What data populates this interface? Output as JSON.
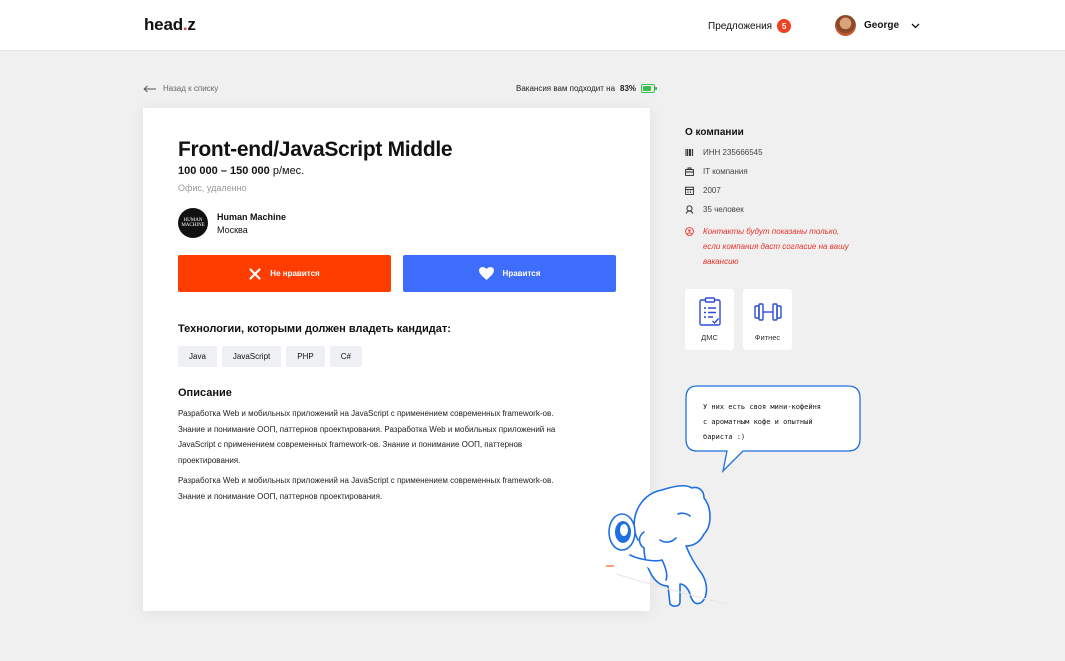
{
  "header": {
    "logo_main": "head",
    "logo_dot": ".",
    "logo_tail": "z",
    "offers_label": "Предложения",
    "offers_count": "5",
    "user_name": "George"
  },
  "nav": {
    "back_label": "Назад к списку",
    "match_label": "Вакансия вам подходит на",
    "match_value": "83%",
    "match_fraction": 0.83
  },
  "vacancy": {
    "title": "Front-end/JavaScript Middle",
    "salary_range": "100 000 – 150 000",
    "salary_unit": "р/мес.",
    "work_type": "Офис, удаленно",
    "company_name": "Human Machine",
    "company_city": "Москва",
    "company_logo_text": "HUMAN MACHINE",
    "dislike_label": "Не нравится",
    "like_label": "Нравится",
    "tech_heading": "Технологии, которыми должен владеть кандидат:",
    "tech_tags": [
      "Java",
      "JavaScript",
      "PHP",
      "C#"
    ],
    "desc_heading": "Описание",
    "desc_paragraphs": [
      "Разработка Web и мобильных приложений на JavaScript с применением современных framework-ов. Знание и понимание ООП, паттернов проектирования. Разработка Web и мобильных приложений на JavaScript с применением современных framework-ов. Знание и понимание ООП, паттернов проектирования.",
      "Разработка Web и мобильных приложений на JavaScript с применением современных framework-ов. Знание и понимание ООП, паттернов проектирования."
    ]
  },
  "about": {
    "heading": "О компании",
    "inn": "ИНН 235666545",
    "type": "IT компания",
    "year": "2007",
    "staff": "35 человек",
    "contacts_note_1": "Контакты будут показаны только,",
    "contacts_note_2": "если компания даст согласие на вашу",
    "contacts_note_3": "вакансию",
    "benefit_1": "ДМС",
    "benefit_2": "Фитнес"
  },
  "bubble": {
    "line_1": "У них есть своя мини-кофейня",
    "line_2": "с ароматным кофе и опытный",
    "line_3": "бариста :)"
  },
  "colors": {
    "dislike": "#ff3d00",
    "like": "#3f6dfb",
    "accent_blue": "#1f6fe0",
    "warning": "#e8322a",
    "battery": "#3bbf4c"
  }
}
